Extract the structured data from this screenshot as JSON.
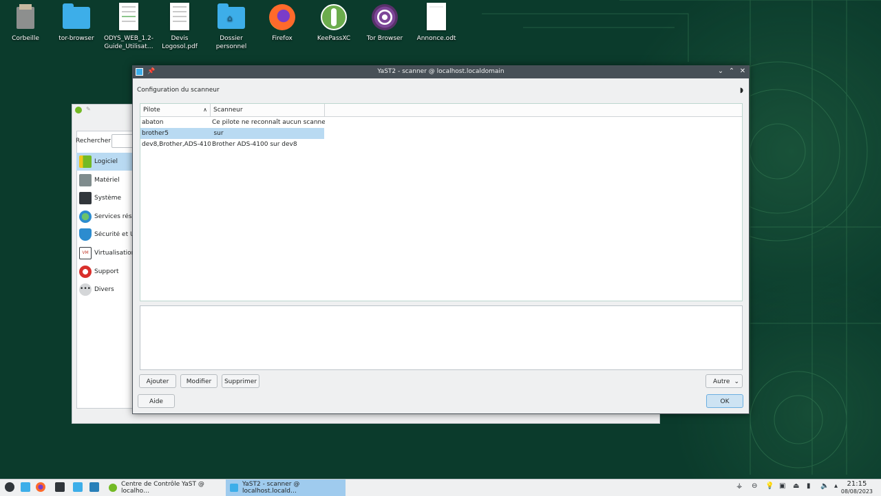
{
  "desktop": {
    "icons": [
      {
        "label": "Corbeille",
        "icon": "trash-icon"
      },
      {
        "label": "tor-browser",
        "icon": "folder-icon"
      },
      {
        "label": "ODYS_WEB_1.2-Guide_Utilisat…",
        "icon": "document-icon"
      },
      {
        "label": "Devis Logosol.pdf",
        "icon": "pdf-icon"
      },
      {
        "label": "Dossier personnel",
        "icon": "home-folder-icon"
      },
      {
        "label": "Firefox",
        "icon": "firefox-icon"
      },
      {
        "label": "KeePassXC",
        "icon": "keepassxc-icon"
      },
      {
        "label": "Tor Browser",
        "icon": "tor-browser-icon"
      },
      {
        "label": "Annonce.odt",
        "icon": "odt-document-icon"
      }
    ]
  },
  "control_center": {
    "search_label": "Rechercher",
    "categories": [
      {
        "label": "Logiciel",
        "selected": true
      },
      {
        "label": "Matériel"
      },
      {
        "label": "Système"
      },
      {
        "label": "Services résea"
      },
      {
        "label": "Sécurité et Ut"
      },
      {
        "label": "Virtualisation"
      },
      {
        "label": "Support"
      },
      {
        "label": "Divers"
      }
    ]
  },
  "window": {
    "title": "YaST2 - scanner @ localhost.localdomain",
    "heading": "Configuration du scanneur",
    "columns": [
      "Pilote",
      "Scanneur"
    ],
    "rows": [
      {
        "pilote": "abaton",
        "scanneur": "Ce pilote ne reconnaît aucun scanneur"
      },
      {
        "pilote": "brother5",
        "scanneur": " sur ",
        "selected": true
      },
      {
        "pilote": "dev8,Brother,ADS-4100",
        "scanneur": "Brother ADS-4100 sur dev8"
      }
    ],
    "buttons": {
      "add": "Ajouter",
      "edit": "Modifier",
      "delete": "Supprimer",
      "other": "Autre",
      "help": "Aide",
      "ok": "OK"
    }
  },
  "taskbar": {
    "tasks": [
      {
        "label": "Centre de Contrôle YaST @ localho…"
      },
      {
        "label": "YaST2 - scanner @ localhost.locald…",
        "active": true
      }
    ],
    "time": "21:15",
    "date": "08/08/2023"
  },
  "colors": {
    "accent": "#3daee9",
    "selection": "#b9daf2",
    "titlebar": "#475057"
  }
}
